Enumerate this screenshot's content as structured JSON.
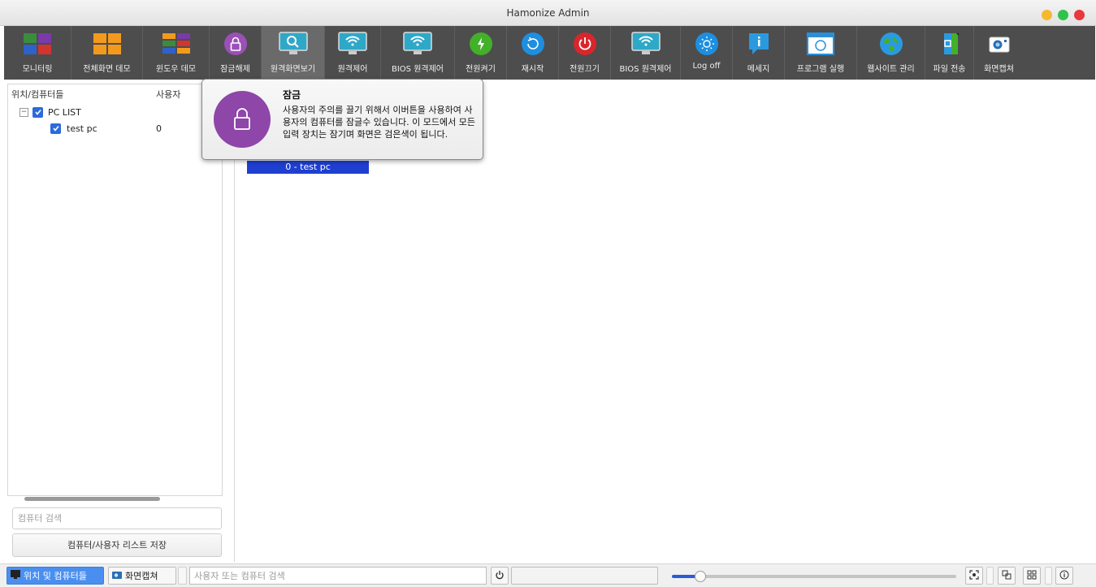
{
  "window": {
    "title": "Hamonize Admin"
  },
  "toolbar": {
    "items": [
      {
        "label": "모니터링",
        "icon": "monitoring-grid-icon"
      },
      {
        "label": "전체화면 데모",
        "icon": "fullscreen-demo-icon"
      },
      {
        "label": "윈도우 데모",
        "icon": "window-demo-icon"
      },
      {
        "label": "잠금해제",
        "icon": "lock-icon"
      },
      {
        "label": "원격화면보기",
        "icon": "remote-view-icon"
      },
      {
        "label": "원격제어",
        "icon": "remote-control-icon"
      },
      {
        "label": "BIOS 원격제어",
        "icon": "bios-remote-control-icon"
      },
      {
        "label": "전원켜기",
        "icon": "power-on-icon"
      },
      {
        "label": "재시작",
        "icon": "reboot-icon"
      },
      {
        "label": "전원끄기",
        "icon": "power-off-icon"
      },
      {
        "label": "BIOS 원격제어",
        "icon": "bios-remote-control-icon"
      },
      {
        "label": "Log off",
        "icon": "log-off-icon"
      },
      {
        "label": "메세지",
        "icon": "message-icon"
      },
      {
        "label": "프로그램 실행",
        "icon": "run-program-icon"
      },
      {
        "label": "웹사이트 관리",
        "icon": "website-icon"
      },
      {
        "label": "파일 전송",
        "icon": "file-transfer-icon"
      },
      {
        "label": "화면캡쳐",
        "icon": "camera-icon"
      }
    ]
  },
  "left_panel": {
    "col_location": "위치/컴퓨터들",
    "col_user": "사용자",
    "group_label": "PC LIST",
    "group_expander": "−",
    "pc_name": "test pc",
    "pc_user_count": "0",
    "search_placeholder": "컴퓨터 검색",
    "save_button": "컴퓨터/사용자 리스트 저장"
  },
  "main": {
    "tile_label": "0 - test pc"
  },
  "tooltip": {
    "title": "잠금",
    "text": "사용자의 주의를 끌기 위해서 이버튼을 사용하여 사용자의 컴퓨터를 잠글수 있습니다. 이 모드에서 모든 입력 장치는 잠기며 화면은 검은색이 됩니다.",
    "icon": "lock-icon"
  },
  "bottom_bar": {
    "locations_button": "위치 및 컴퓨터들",
    "screenshot_button": "화면캡쳐",
    "search_placeholder": "사용자 또는 컴퓨터 검색",
    "zoom_level_fraction": 0.1
  },
  "colors": {
    "toolbar_bg": "#4d4d4d",
    "accent_blue": "#1f3fd0",
    "lock_purple": "#8e46a8",
    "win_yellow": "#f5b82e",
    "win_green": "#2ec44a",
    "win_red": "#e8373d"
  }
}
